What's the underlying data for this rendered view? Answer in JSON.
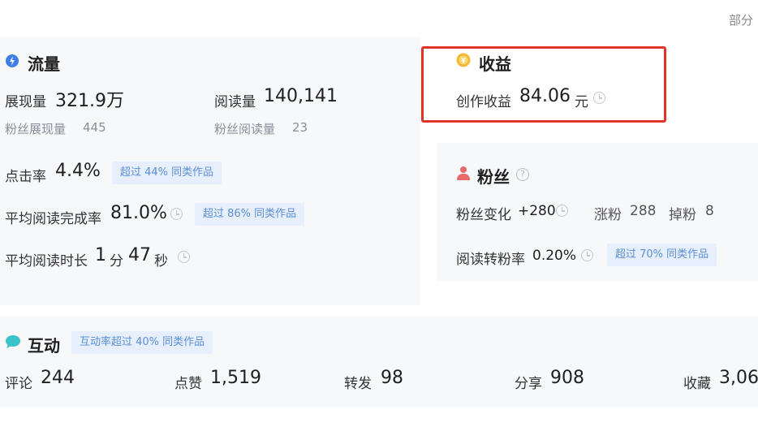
{
  "top_right_text": "部分",
  "traffic": {
    "title": "流量",
    "impressions_label": "展现量",
    "impressions_value": "321.9万",
    "reads_label": "阅读量",
    "reads_value": "140,141",
    "fan_impressions_label": "粉丝展现量",
    "fan_impressions_value": "445",
    "fan_reads_label": "粉丝阅读量",
    "fan_reads_value": "23",
    "ctr_label": "点击率",
    "ctr_value": "4.4%",
    "ctr_badge": "超过 44% 同类作品",
    "completion_label": "平均阅读完成率",
    "completion_value": "81.0%",
    "completion_badge": "超过 86% 同类作品",
    "duration_label": "平均阅读时长",
    "duration_min": "1",
    "duration_min_unit": "分",
    "duration_sec": "47",
    "duration_sec_unit": "秒"
  },
  "income": {
    "title": "收益",
    "creation_label": "创作收益",
    "creation_value": "84.06",
    "creation_unit": "元",
    "highlight_color": "#e0342b"
  },
  "fans": {
    "title": "粉丝",
    "change_label": "粉丝变化",
    "change_value": "+280",
    "gain_label": "涨粉",
    "gain_value": "288",
    "loss_label": "掉粉",
    "loss_value": "8",
    "conversion_label": "阅读转粉率",
    "conversion_value": "0.20%",
    "conversion_badge": "超过 70% 同类作品"
  },
  "interaction": {
    "title": "互动",
    "badge": "互动率超过 40% 同类作品",
    "comments_label": "评论",
    "comments_value": "244",
    "likes_label": "点赞",
    "likes_value": "1,519",
    "reposts_label": "转发",
    "reposts_value": "98",
    "shares_label": "分享",
    "shares_value": "908",
    "favorites_label": "收藏",
    "favorites_value": "3,06"
  }
}
